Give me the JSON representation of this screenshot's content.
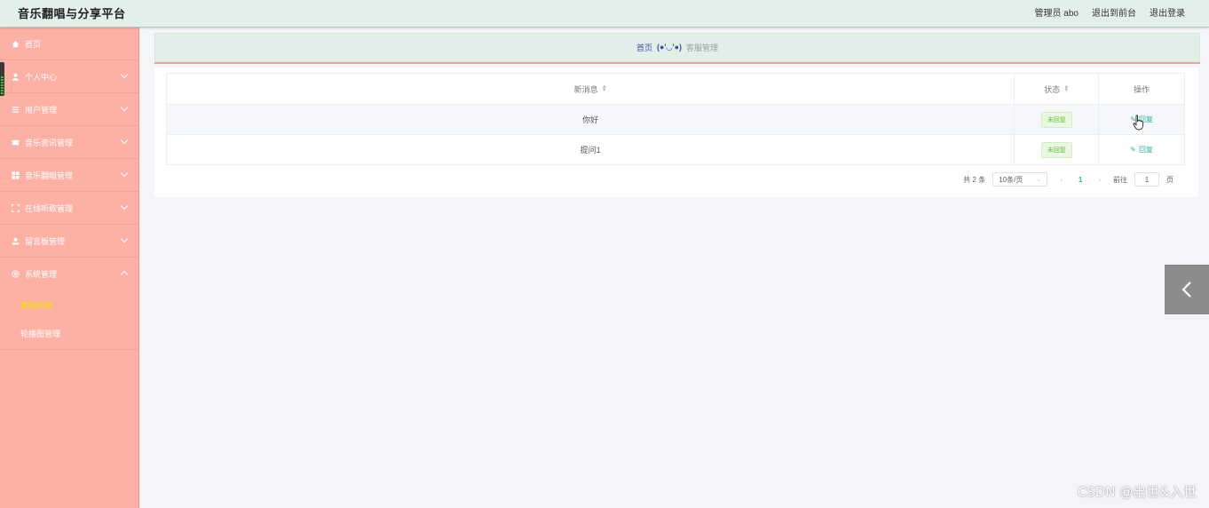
{
  "app": {
    "title": "音乐翻唱与分享平台"
  },
  "header": {
    "user_label": "管理员 abo",
    "to_front_label": "退出到前台",
    "logout_label": "退出登录"
  },
  "sidebar": {
    "items": [
      {
        "label": "首页",
        "icon": "home-icon",
        "expandable": false
      },
      {
        "label": "个人中心",
        "icon": "user-icon",
        "expandable": true
      },
      {
        "label": "用户管理",
        "icon": "list-icon",
        "expandable": true
      },
      {
        "label": "音乐资讯管理",
        "icon": "ticket-icon",
        "expandable": true
      },
      {
        "label": "音乐翻唱管理",
        "icon": "grid-icon",
        "expandable": true
      },
      {
        "label": "在线听歌管理",
        "icon": "frame-icon",
        "expandable": true
      },
      {
        "label": "留言板管理",
        "icon": "person-stamp-icon",
        "expandable": true
      },
      {
        "label": "系统管理",
        "icon": "gear-icon",
        "expandable": true,
        "expanded": true
      }
    ],
    "sub_items": [
      {
        "label": "客服管理",
        "active": true
      },
      {
        "label": "轮播图管理",
        "active": false
      }
    ],
    "active_color": "#f5e400"
  },
  "breadcrumb": {
    "home": "首页",
    "face": "(●'◡'●)",
    "current": "客服管理"
  },
  "table": {
    "columns": [
      "新消息",
      "状态",
      "操作"
    ],
    "rows": [
      {
        "message": "你好",
        "status": "未回复",
        "action": "回复"
      },
      {
        "message": "提问1",
        "status": "未回复",
        "action": "回复"
      }
    ]
  },
  "pagination": {
    "total_label": "共 2 条",
    "page_size_label": "10条/页",
    "current_page": "1",
    "goto_label": "前往",
    "goto_value": "1",
    "page_suffix": "页"
  },
  "watermark": "CSDN @出世&入世",
  "colors": {
    "topbar_bg": "#e3efea",
    "sidebar_bg": "#fdb1a4",
    "accent_teal": "#2bb0a2",
    "tag_green": "#67c23a"
  }
}
